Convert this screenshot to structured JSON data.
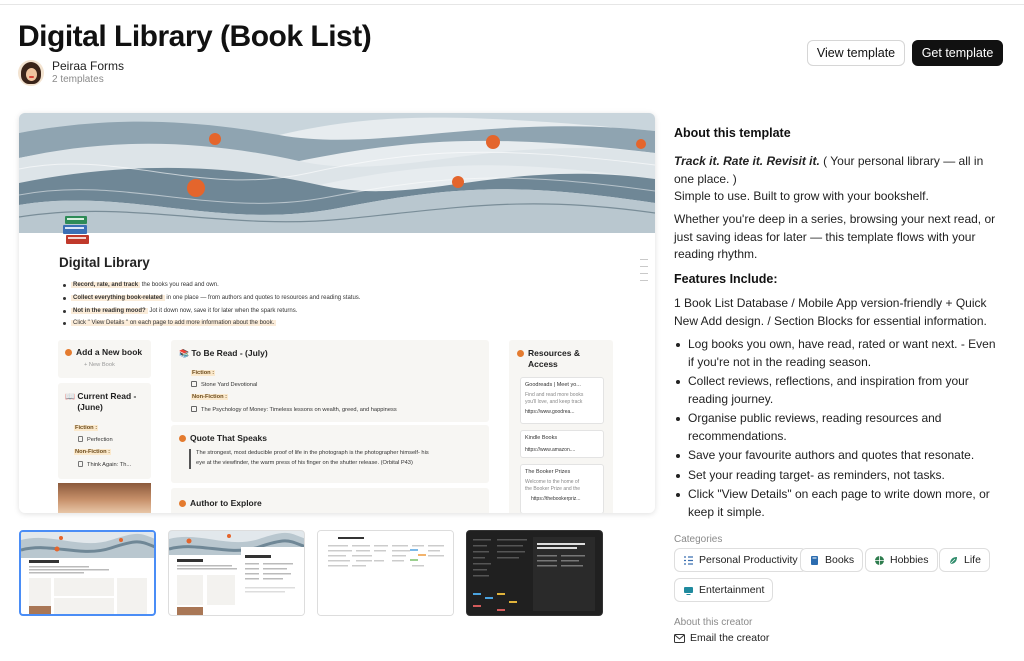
{
  "header": {
    "title": "Digital Library (Book List)",
    "creator_name": "Peiraa Forms",
    "creator_count": "2 templates",
    "view_button": "View template",
    "get_button": "Get template"
  },
  "preview": {
    "doc_title": "Digital Library",
    "bullets": [
      {
        "bold": "Record, rate, and track",
        "rest": " the books you read and own."
      },
      {
        "bold": "Collect everything book-related",
        "rest": " in one place — from authors and quotes to resources and reading status."
      },
      {
        "bold": "Not in the reading mood?",
        "rest": " Jot it down now, save it for later when the spark returns."
      },
      {
        "bold": "",
        "rest": "Click \" View Details \" on each page to add more information about the book."
      }
    ],
    "add_book": {
      "title": "Add a New book",
      "button": "New Book"
    },
    "current_read": {
      "title": "Current Read - (June)",
      "fiction_label": "Fiction :",
      "fiction_item": "Perfection",
      "nonfiction_label": "Non-Fiction :",
      "nonfiction_item": "Think Again: Th..."
    },
    "to_be_read": {
      "title": "To Be Read - (July)",
      "fiction_label": "Fiction :",
      "fiction_item": "Stone Yard Devotional",
      "nonfiction_label": "Non-Fiction :",
      "nonfiction_item": "The Psychology of Money: Timeless lessons on wealth, greed, and happiness"
    },
    "quote": {
      "title": "Quote That Speaks",
      "line1": "The strongest, most deducible proof of life in the photograph is the photographer himself- his",
      "line2": "eye at the viewfinder, the warm press of his finger on the shutter release. (Orbital P43)"
    },
    "author": {
      "title": "Author to Explore"
    },
    "resources": {
      "title_line1": "Resources &",
      "title_line2": "Access",
      "cards": [
        {
          "title": "Goodreads | Meet yo...",
          "desc1": "Find and read more books",
          "desc2": "you'll love, and keep track",
          "url": "https://www.goodrea..."
        },
        {
          "title": "Kindle Books",
          "url": "https://www.amazon...."
        },
        {
          "title": "The Booker Prizes",
          "desc1": "Welcome to the home of",
          "desc2": "the Booker Prize and the",
          "url": "https://thebookerpriz..."
        }
      ]
    }
  },
  "about": {
    "title": "About this template",
    "tagline": "Track it. Rate it. Revisit it.",
    "tagline_rest": " ( Your personal library — all in one place. )",
    "line2": "Simple to use. Built to grow with your bookshelf.",
    "para2": "Whether you're deep in a series, browsing your next read, or just saving ideas for later — this template flows with your reading rhythm.",
    "features_title": "Features Include:",
    "features_intro": "1 Book List Database / Mobile App version-friendly + Quick New Add design. / Section Blocks for essential information.",
    "features": [
      "Log books you own, have read, rated or want next. - Even if you're not in the reading season.",
      "Collect reviews, reflections, and inspiration from your reading journey.",
      "Organise public reviews, reading resources and recommendations.",
      "Save your favourite authors and quotes that resonate.",
      "Set your reading target- as reminders, not tasks.",
      "Click \"View Details\" on each page to write down more, or keep it simple."
    ]
  },
  "categories": {
    "label": "Categories",
    "items": [
      {
        "label": "Personal Productivity",
        "icon": "checklist-icon"
      },
      {
        "label": "Books",
        "icon": "book-icon"
      },
      {
        "label": "Hobbies",
        "icon": "ball-icon"
      },
      {
        "label": "Life",
        "icon": "leaf-icon"
      },
      {
        "label": "Entertainment",
        "icon": "tv-icon"
      }
    ]
  },
  "creator_section": {
    "label": "About this creator",
    "email": "Email the creator"
  },
  "thumbnails": {
    "items": [
      {
        "title": "Digital Library",
        "theme": "light",
        "active": true
      },
      {
        "title": "Digital Library",
        "theme": "light",
        "active": false
      },
      {
        "title": "Book List You",
        "theme": "table",
        "active": false
      },
      {
        "title": "Think Again: The Power of Knowing What You Don't Know",
        "theme": "dark",
        "active": false
      }
    ]
  },
  "colors": {
    "accent_orange": "#e47b2f",
    "wave_blue": "#7a93a3",
    "highlight": "#fbe9cc",
    "active_border": "#4a8df6",
    "dark_button": "#111111"
  }
}
